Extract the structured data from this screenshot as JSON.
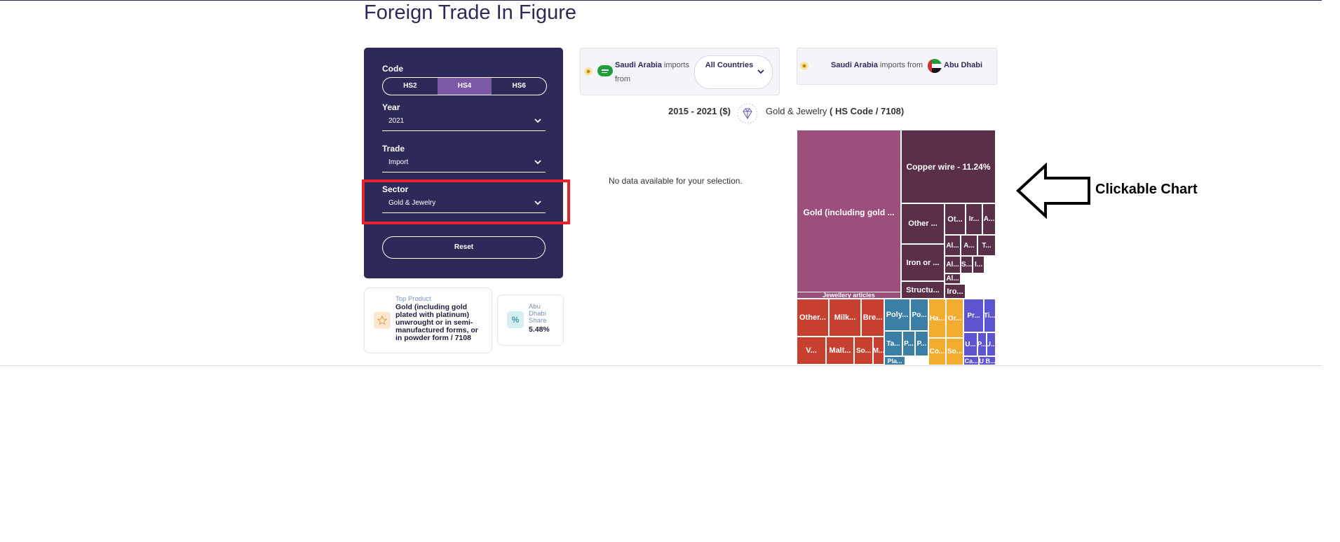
{
  "page": {
    "title": "Foreign Trade In Figure"
  },
  "filters": {
    "code_label": "Code",
    "code_options": [
      "HS2",
      "HS4",
      "HS6"
    ],
    "code_active": "HS4",
    "year_label": "Year",
    "year_value": "2021",
    "trade_label": "Trade",
    "trade_value": "Import",
    "sector_label": "Sector",
    "sector_value": "Gold & Jewelry",
    "reset_label": "Reset"
  },
  "cards": {
    "top_product_label": "Top Product",
    "top_product_value": "Gold (including gold plated with platinum) unwrought or in semi-manufactured forms, or in powder form / 7108",
    "share_label": "Abu Dhabi Share",
    "share_value": "5.48%"
  },
  "left_pill": {
    "country": "Saudi Arabia",
    "suffix": "imports from",
    "select_value": "All Countries"
  },
  "right_pill": {
    "country": "Saudi Arabia",
    "middle": "imports from",
    "partner": "Abu Dhabi"
  },
  "subtitle": {
    "range": "2015 - 2021 ($)",
    "sector": "Gold & Jewelry",
    "code": "( HS Code / 7108)"
  },
  "no_data": "No data available for your selection.",
  "annotation": "Clickable Chart",
  "colors": {
    "navy": "#2d2a5a",
    "accent": "#7a5aa6",
    "highlight": "#e8232c",
    "treemap_purple": "#9c4f7a",
    "treemap_dark": "#5a3048",
    "treemap_red": "#c8402f",
    "treemap_blue": "#3b7fa6",
    "treemap_orange": "#f2ac2e",
    "treemap_violet": "#5c54d0"
  },
  "chart_data": {
    "type": "treemap",
    "cells": [
      {
        "label": "Gold (including gold ...",
        "group": "purple"
      },
      {
        "label": "Jewellery articles",
        "group": "purple"
      },
      {
        "label": "Copper wire - 11.24%",
        "group": "dark"
      },
      {
        "label": "Other ...",
        "group": "dark"
      },
      {
        "label": "Iron or ...",
        "group": "dark"
      },
      {
        "label": "Structu...",
        "group": "dark"
      },
      {
        "label": "Ot...",
        "group": "dark"
      },
      {
        "label": "Ir...",
        "group": "dark"
      },
      {
        "label": "A...",
        "group": "dark"
      },
      {
        "label": "Al...",
        "group": "dark"
      },
      {
        "label": "A...",
        "group": "dark"
      },
      {
        "label": "T...",
        "group": "dark"
      },
      {
        "label": "Al...",
        "group": "dark"
      },
      {
        "label": "S...",
        "group": "dark"
      },
      {
        "label": "I...",
        "group": "dark"
      },
      {
        "label": "Al...",
        "group": "dark"
      },
      {
        "label": "Iro...",
        "group": "dark"
      },
      {
        "label": "Other...",
        "group": "red"
      },
      {
        "label": "Milk...",
        "group": "red"
      },
      {
        "label": "Bre...",
        "group": "red"
      },
      {
        "label": "V...",
        "group": "red"
      },
      {
        "label": "Malt...",
        "group": "red"
      },
      {
        "label": "So...",
        "group": "red"
      },
      {
        "label": "M...",
        "group": "red"
      },
      {
        "label": "Poly...",
        "group": "blue"
      },
      {
        "label": "Po...",
        "group": "blue"
      },
      {
        "label": "Ta...",
        "group": "blue"
      },
      {
        "label": "P...",
        "group": "blue"
      },
      {
        "label": "P...",
        "group": "blue"
      },
      {
        "label": "Pla...",
        "group": "blue"
      },
      {
        "label": "Ha...",
        "group": "orange"
      },
      {
        "label": "Or...",
        "group": "orange"
      },
      {
        "label": "Co...",
        "group": "orange"
      },
      {
        "label": "So...",
        "group": "orange"
      },
      {
        "label": "Pr...",
        "group": "violet"
      },
      {
        "label": "Ti...",
        "group": "violet"
      },
      {
        "label": "U...",
        "group": "violet"
      },
      {
        "label": "P...",
        "group": "violet"
      },
      {
        "label": "U...",
        "group": "violet"
      },
      {
        "label": "Ca...",
        "group": "violet"
      },
      {
        "label": "U B...",
        "group": "violet"
      }
    ]
  }
}
